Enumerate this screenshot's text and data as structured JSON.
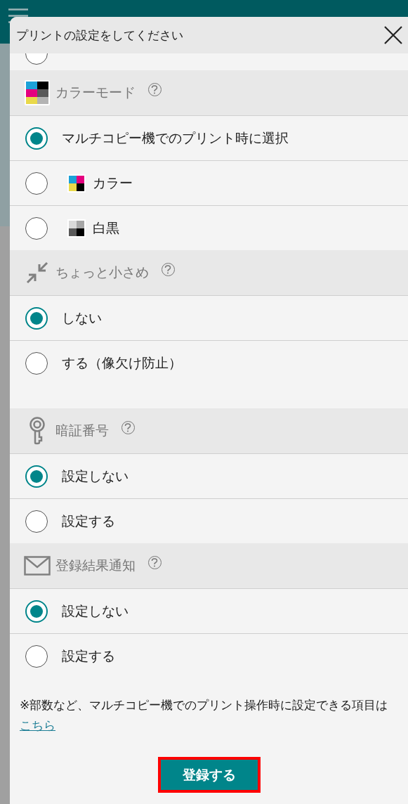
{
  "dialog": {
    "title": "プリントの設定をしてください"
  },
  "partial_option": {
    "selected": false
  },
  "sections": [
    {
      "title": "カラーモード",
      "kind": "color-grid",
      "options": [
        {
          "label": "マルチコピー機でのプリント時に選択",
          "selected": true
        },
        {
          "label": "カラー",
          "selected": false,
          "kind": "color"
        },
        {
          "label": "白黒",
          "selected": false,
          "kind": "mono"
        }
      ]
    },
    {
      "title": "ちょっと小さめ",
      "kind": "shrink",
      "options": [
        {
          "label": "しない",
          "selected": true
        },
        {
          "label": "する（像欠け防止）",
          "selected": false
        }
      ]
    },
    {
      "title": "暗証番号",
      "kind": "key",
      "options": [
        {
          "label": "設定しない",
          "selected": true
        },
        {
          "label": "設定する",
          "selected": false
        }
      ]
    },
    {
      "title": "登録結果通知",
      "kind": "mail",
      "options": [
        {
          "label": "設定しない",
          "selected": true
        },
        {
          "label": "設定する",
          "selected": false
        }
      ]
    }
  ],
  "note": {
    "text": "※部数など、マルチコピー機でのプリント操作時に設定できる項目は",
    "link": "こちら"
  },
  "submit_button": "登録する"
}
